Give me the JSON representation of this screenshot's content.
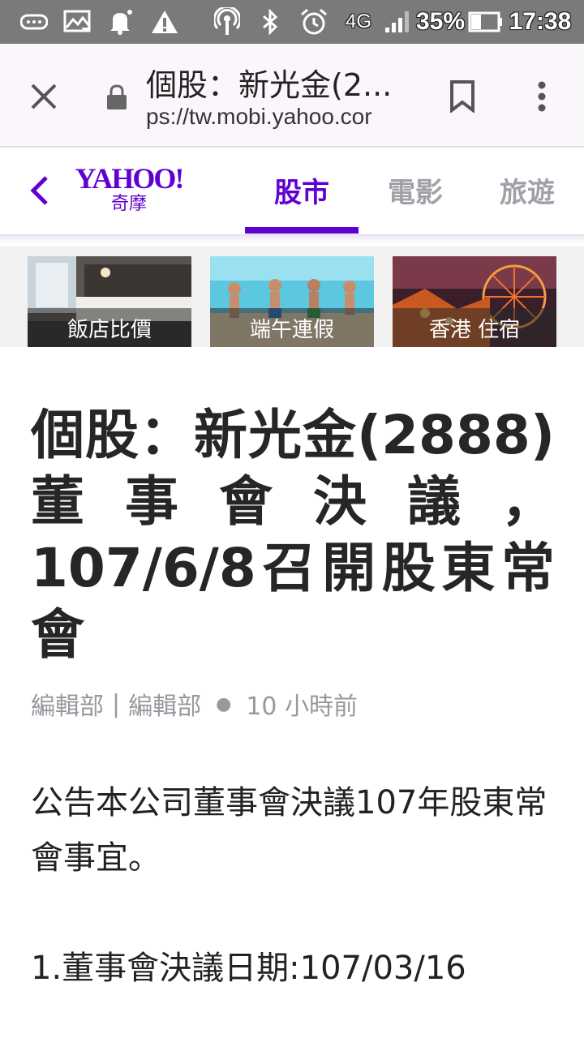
{
  "status_bar": {
    "battery": "35%",
    "time": "17:38",
    "network": "4G",
    "icons": [
      "voicemail-icon",
      "gallery-icon",
      "notification-bell-icon",
      "warning-icon",
      "hotspot-icon",
      "bluetooth-icon",
      "alarm-icon",
      "signal-icon",
      "battery-icon"
    ]
  },
  "browser": {
    "title": "個股：新光金(2...",
    "url": "ps://tw.mobi.yahoo.cor",
    "icons": [
      "close-icon",
      "lock-icon",
      "bookmark-icon",
      "more-vert-icon"
    ]
  },
  "nav": {
    "logo_text": "YAHOO!",
    "logo_sub": "奇摩",
    "tabs": [
      {
        "label": "股市",
        "active": true
      },
      {
        "label": "電影",
        "active": false
      },
      {
        "label": "旅遊",
        "active": false
      }
    ],
    "accent": "#6001d2"
  },
  "ads": [
    {
      "caption": "飯店比價"
    },
    {
      "caption": "端午連假"
    },
    {
      "caption": "香港 住宿"
    }
  ],
  "article": {
    "headline": "個股：新光金(2888)董事會決議，107/6/8召開股東常會",
    "author1": "編輯部",
    "separator": "|",
    "author2": "編輯部",
    "time_ago": "10 小時前",
    "paragraph1": "公告本公司董事會決議107年股東常會事宜。",
    "paragraph2": "1.董事會決議日期:107/03/16"
  }
}
